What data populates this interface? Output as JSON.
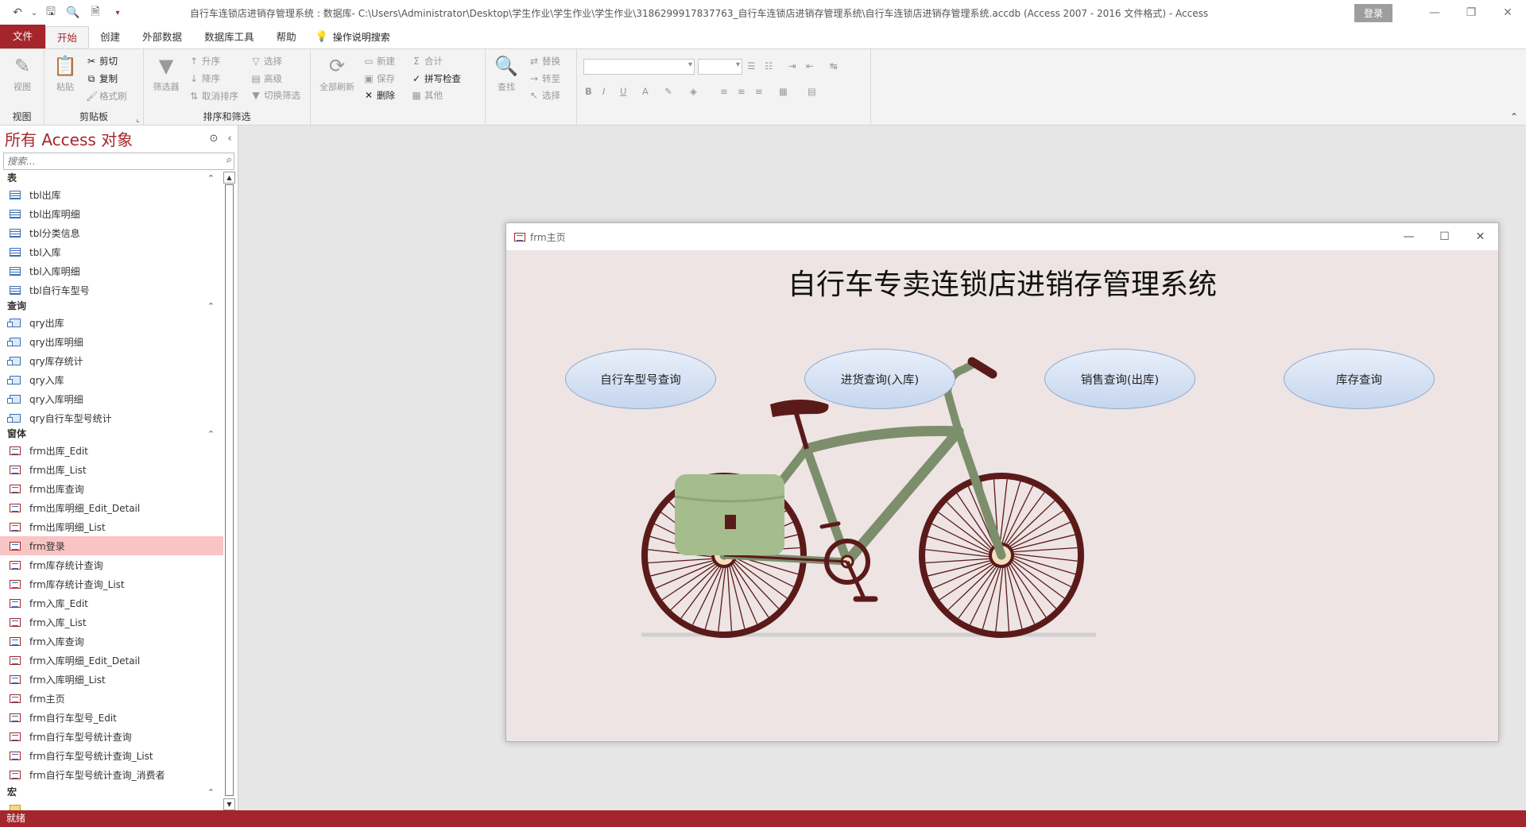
{
  "titlebar": {
    "doc_title": "自行车连锁店进销存管理系统 : 数据库- C:\\Users\\Administrator\\Desktop\\学生作业\\学生作业\\学生作业\\3186299917837763_自行车连锁店进销存管理系统\\自行车连锁店进销存管理系统.accdb (Access 2007 - 2016 文件格式)  -  Access",
    "signin": "登录",
    "qat": {
      "undo": "↶",
      "undo_more": "⌄",
      "save": "🖫",
      "preview": "🔍",
      "print": "🗎",
      "custom": "▾"
    },
    "controls": {
      "minimize": "—",
      "restore": "❐",
      "close": "✕"
    }
  },
  "tabs": {
    "file": "文件",
    "home": "开始",
    "create": "创建",
    "external": "外部数据",
    "dbtools": "数据库工具",
    "help": "帮助",
    "tell_me": "操作说明搜索",
    "bulb": "💡"
  },
  "ribbon": {
    "views": {
      "view": "视图",
      "label": "视图",
      "icon": "✎"
    },
    "clipboard": {
      "paste": "粘贴",
      "cut": "剪切",
      "copy": "复制",
      "format_painter": "格式刷",
      "label": "剪贴板",
      "launcher": "⌞",
      "cut_icon": "✂",
      "copy_icon": "⧉",
      "paste_icon": "📋",
      "fp_icon": "🖌"
    },
    "sort_filter": {
      "filter": "筛选器",
      "asc": "升序",
      "desc": "降序",
      "remove_sort": "取消排序",
      "selection": "选择",
      "advanced": "高级",
      "toggle": "切换筛选",
      "label": "排序和筛选",
      "funnel": "▼"
    },
    "records": {
      "refresh_all": "全部刷新",
      "new": "新建",
      "save": "保存",
      "delete": "删除",
      "totals": "合计",
      "spelling": "拼写检查",
      "more": "其他"
    },
    "find": {
      "find": "查找",
      "replace": "替换",
      "goto": "转至",
      "select": "选择",
      "find_icon": "🔍"
    },
    "text_format": {
      "bold": "B",
      "italic": "I",
      "underline": "U",
      "font_color": "A",
      "highlight": "✎",
      "fill": "◈"
    },
    "collapse": "⌃"
  },
  "nav": {
    "title": "所有 Access 对象",
    "header_menu": "⊙",
    "header_close": "‹",
    "search_placeholder": "搜索...",
    "search_icon": "⌕",
    "scroll_up": "▲",
    "scroll_down": "▼",
    "groups": {
      "tables": {
        "label": "表",
        "caret": "⌃",
        "items": [
          "tbl出库",
          "tbl出库明细",
          "tbl分类信息",
          "tbl入库",
          "tbl入库明细",
          "tbl自行车型号"
        ]
      },
      "queries": {
        "label": "查询",
        "caret": "⌃",
        "items": [
          "qry出库",
          "qry出库明细",
          "qry库存统计",
          "qry入库",
          "qry入库明细",
          "qry自行车型号统计"
        ]
      },
      "forms": {
        "label": "窗体",
        "caret": "⌃",
        "items": [
          "frm出库_Edit",
          "frm出库_List",
          "frm出库查询",
          "frm出库明细_Edit_Detail",
          "frm出库明细_List",
          "frm登录",
          "frm库存统计查询",
          "frm库存统计查询_List",
          "frm入库_Edit",
          "frm入库_List",
          "frm入库查询",
          "frm入库明细_Edit_Detail",
          "frm入库明细_List",
          "frm主页",
          "frm自行车型号_Edit",
          "frm自行车型号统计查询",
          "frm自行车型号统计查询_List",
          "frm自行车型号统计查询_消费者"
        ]
      },
      "macros": {
        "label": "宏",
        "caret": "⌃"
      }
    }
  },
  "form": {
    "window_title": "frm主页",
    "controls": {
      "minimize": "—",
      "restore": "☐",
      "close": "✕"
    },
    "main_title": "自行车专卖连锁店进销存管理系统",
    "buttons": {
      "bike_model_query": "自行车型号查询",
      "purchase_query": "进货查询(入库)",
      "sales_query": "销售查询(出库)",
      "stock_query": "库存查询"
    }
  },
  "status": {
    "text": "就绪"
  },
  "colors": {
    "accent": "#a4262c",
    "form_bg": "#ede4e3",
    "bike_frame": "#7d8e6c",
    "wheel": "#5b1a1a",
    "bag": "#a5bd8c"
  }
}
